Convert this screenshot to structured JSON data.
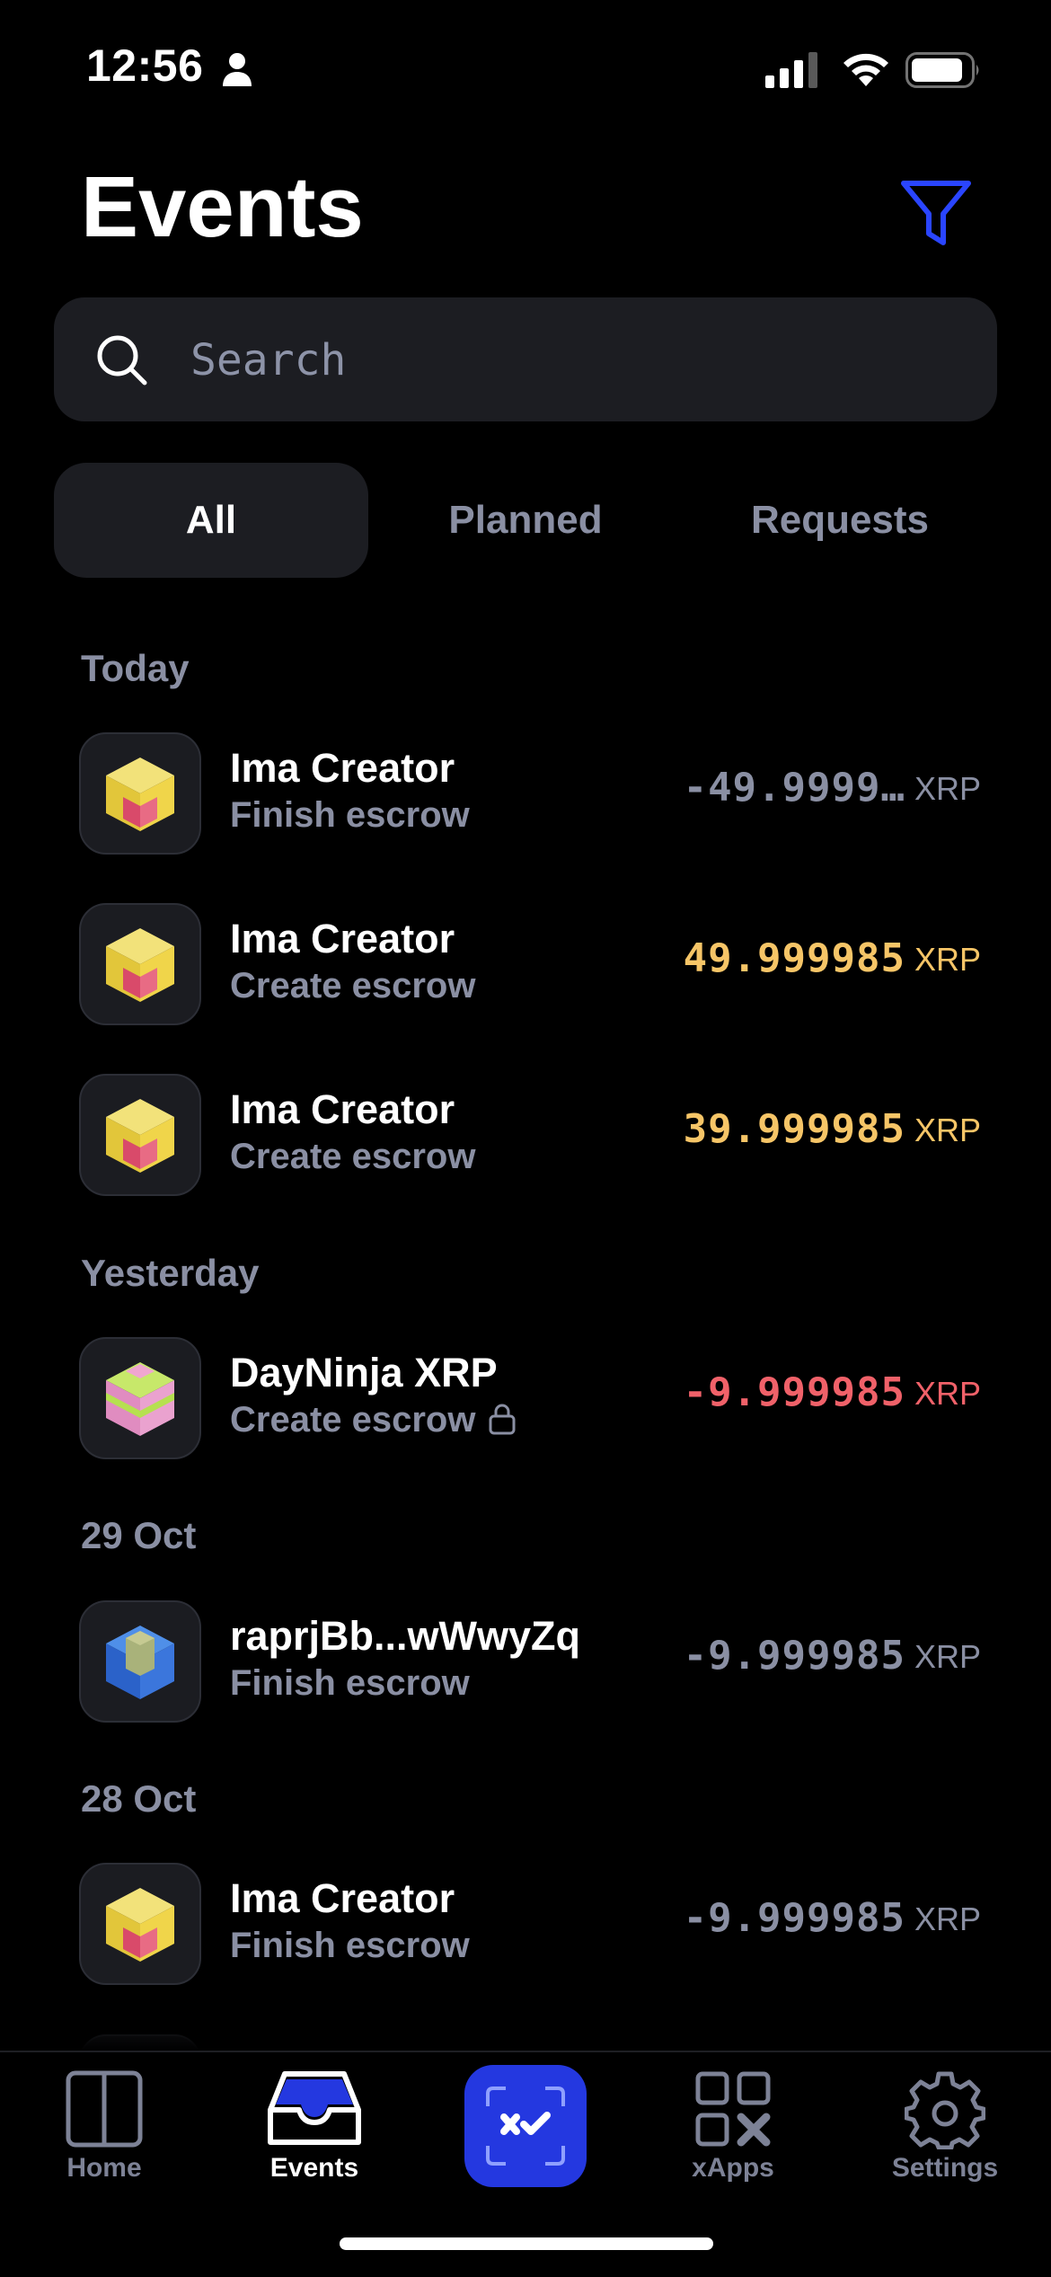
{
  "status_bar": {
    "time": "12:56",
    "icons": [
      "person-icon",
      "cellular-signal-icon",
      "wifi-icon",
      "battery-icon"
    ]
  },
  "header": {
    "title": "Events",
    "filter_icon": "filter-icon"
  },
  "search": {
    "placeholder": "Search",
    "value": ""
  },
  "tabs": [
    {
      "label": "All",
      "active": true
    },
    {
      "label": "Planned",
      "active": false
    },
    {
      "label": "Requests",
      "active": false
    }
  ],
  "sections": [
    {
      "label": "Today",
      "events": [
        {
          "name": "Ima Creator",
          "type": "Finish escrow",
          "amount": "-49.9999…",
          "currency": "XRP",
          "tone": "neutral",
          "avatar": "yellow-cube-icon",
          "locked": false
        },
        {
          "name": "Ima Creator",
          "type": "Create escrow",
          "amount": "49.999985",
          "currency": "XRP",
          "tone": "pending",
          "avatar": "yellow-cube-icon",
          "locked": false
        },
        {
          "name": "Ima Creator",
          "type": "Create escrow",
          "amount": "39.999985",
          "currency": "XRP",
          "tone": "pending",
          "avatar": "yellow-cube-icon",
          "locked": false
        }
      ]
    },
    {
      "label": "Yesterday",
      "events": [
        {
          "name": "DayNinja XRP",
          "type": "Create escrow",
          "amount": "-9.999985",
          "currency": "XRP",
          "tone": "negative",
          "avatar": "pink-cube-icon",
          "locked": true
        }
      ]
    },
    {
      "label": "29 Oct",
      "events": [
        {
          "name": "raprjBb...wWwyZq",
          "type": "Finish escrow",
          "amount": "-9.999985",
          "currency": "XRP",
          "tone": "neutral",
          "avatar": "blue-cube-icon",
          "locked": false
        }
      ]
    },
    {
      "label": "28 Oct",
      "events": [
        {
          "name": "Ima Creator",
          "type": "Finish escrow",
          "amount": "-9.999985",
          "currency": "XRP",
          "tone": "neutral",
          "avatar": "yellow-cube-icon",
          "locked": false
        }
      ]
    }
  ],
  "tab_bar": {
    "items": [
      {
        "label": "Home",
        "icon": "home-panels-icon",
        "active": false
      },
      {
        "label": "Events",
        "icon": "inbox-icon",
        "active": true
      },
      {
        "label": "",
        "icon": "scan-qr-icon",
        "active": false
      },
      {
        "label": "xApps",
        "icon": "xapps-grid-icon",
        "active": false
      },
      {
        "label": "Settings",
        "icon": "gear-icon",
        "active": false
      }
    ]
  },
  "colors": {
    "background": "#000000",
    "surface": "#1c1d22",
    "muted_text": "#8a8fa3",
    "accent_blue": "#2438e0",
    "pending_gold": "#f6c567",
    "negative_red": "#f06169"
  }
}
